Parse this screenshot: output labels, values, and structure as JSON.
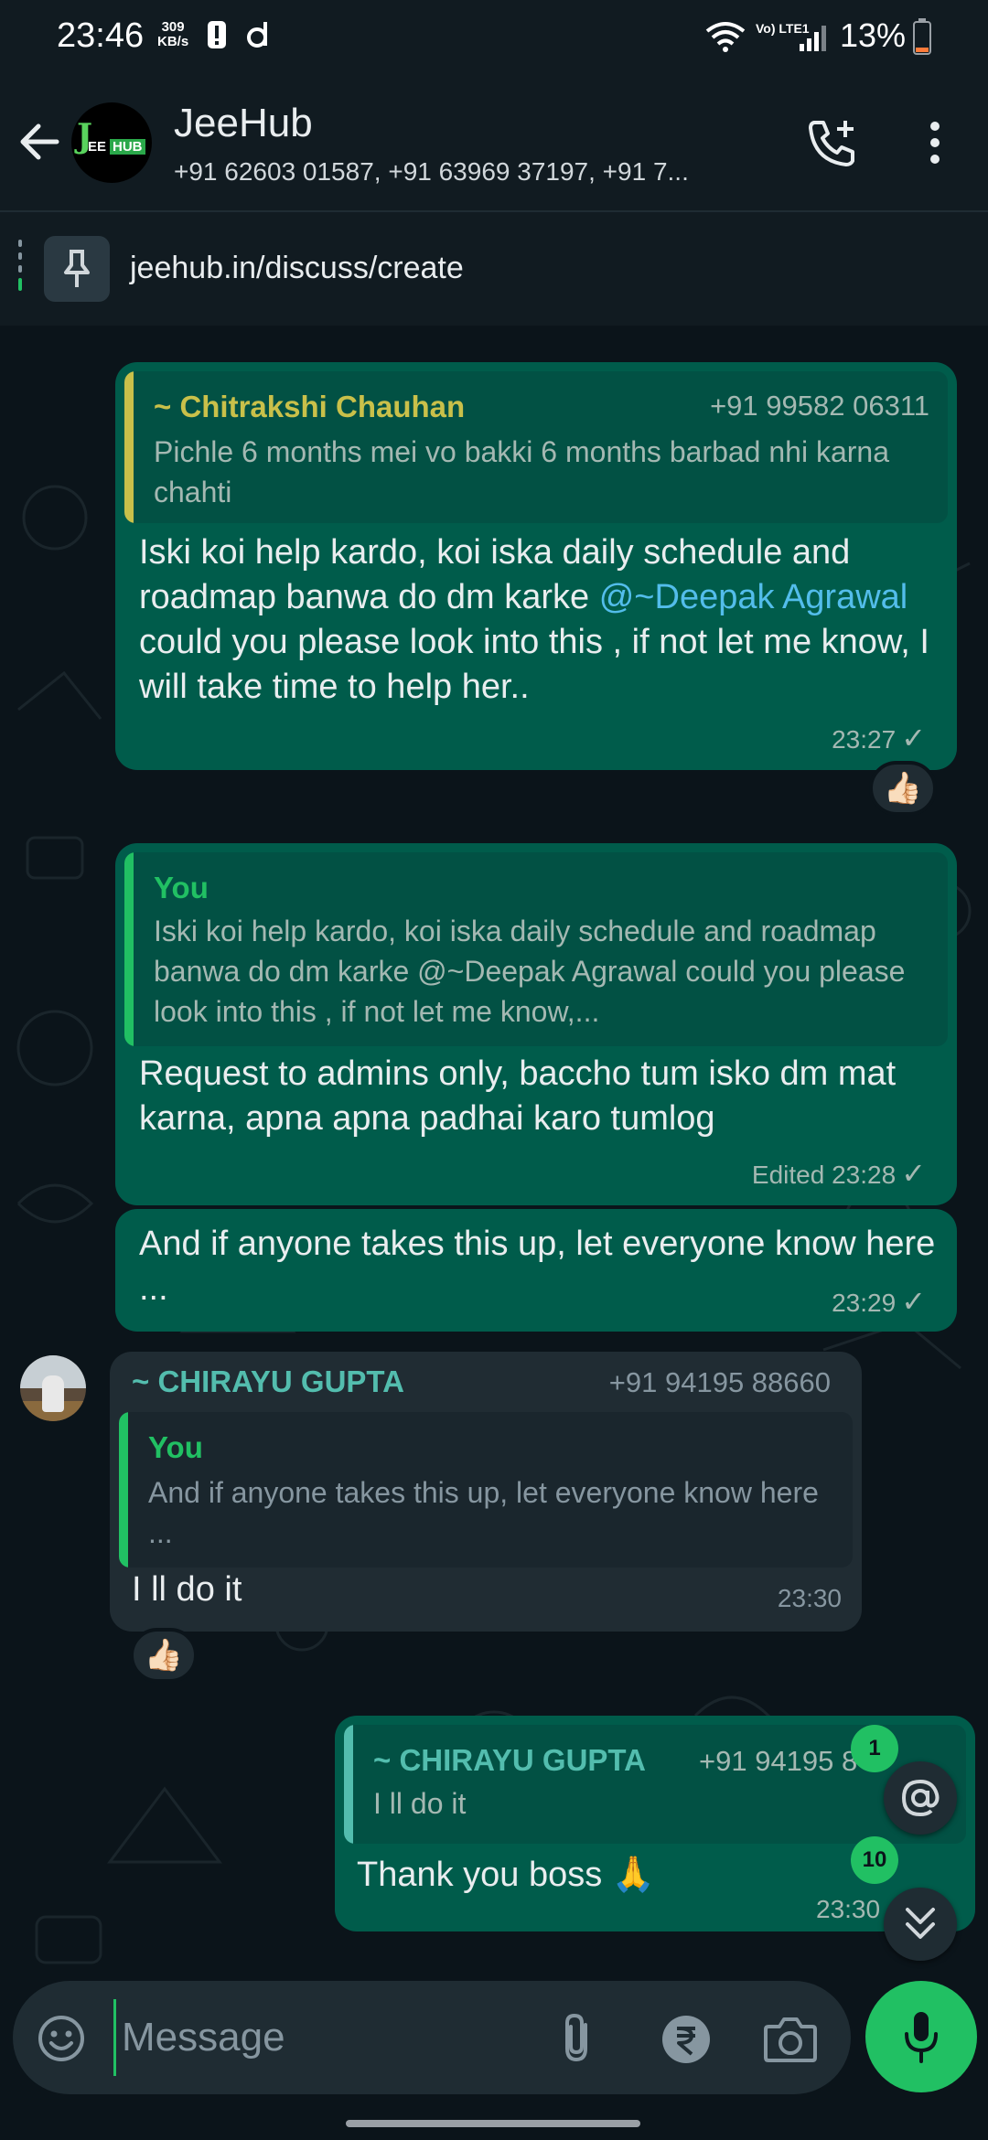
{
  "status_bar": {
    "time": "23:46",
    "speed_value": "309",
    "speed_unit": "KB/s",
    "network": "Vo) LTE1",
    "battery": "13%",
    "icons": [
      "alert-icon",
      "d-app-icon",
      "wifi-icon",
      "signal-icon",
      "battery-icon"
    ]
  },
  "header": {
    "title": "JeeHub",
    "subtitle": "+91 62603 01587, +91 63969 37197, +91 7...",
    "avatar_letters": {
      "j": "J",
      "ee": "EE",
      "hub": "HUB"
    },
    "icons": [
      "back-arrow-icon",
      "add-call-icon",
      "more-vert-icon"
    ]
  },
  "pinned": {
    "text": "jeehub.in/discuss/create",
    "icon": "pin-icon"
  },
  "messages": [
    {
      "direction": "out",
      "quote": {
        "name": "~ Chitrakshi Chauhan",
        "phone": "+91 99582 06311",
        "text": "Pichle 6 months mei vo  bakki 6 months barbad nhi karna chahti",
        "accent": "#c9c04a"
      },
      "text_before": "Iski koi help kardo, koi iska daily schedule and roadmap banwa do dm karke ",
      "mention": "@~Deepak Agrawal",
      "text_after": "  could you please look into this , if not let me know, I will take time to help her..",
      "time": "23:27",
      "reaction": "👍🏻"
    },
    {
      "direction": "out",
      "quote": {
        "name": "You",
        "text": "Iski koi help kardo, koi iska daily schedule and roadmap banwa do dm karke @~Deepak Agrawal could you please look into this , if not let me know,...",
        "accent": "#21c063"
      },
      "text": "Request to admins only, baccho tum isko dm mat karna, apna apna padhai karo tumlog",
      "edited": "Edited",
      "time": "23:28"
    },
    {
      "direction": "out",
      "text": "And if anyone takes this up, let everyone know here ...",
      "time": "23:29"
    },
    {
      "direction": "in",
      "sender": "~ CHIRAYU GUPTA",
      "sender_phone": "+91 94195 88660",
      "quote": {
        "name": "You",
        "text": "And if anyone takes this up, let everyone know here ...",
        "accent": "#21c063"
      },
      "text": "I ll do it",
      "time": "23:30",
      "reaction": "👍🏻"
    },
    {
      "direction": "out",
      "quote": {
        "name": "~ CHIRAYU GUPTA",
        "phone": "+91 94195 8",
        "text": "I ll do it",
        "accent": "#53bdae"
      },
      "text": "Thank you boss 🙏",
      "time": "23:30"
    }
  ],
  "floating": {
    "mention_badge": "1",
    "unread_badge": "10"
  },
  "composer": {
    "placeholder": "Message",
    "icons": [
      "emoji-icon",
      "attach-icon",
      "rupee-icon",
      "camera-icon",
      "mic-icon"
    ]
  },
  "colors": {
    "background": "#0b141a",
    "out_bubble": "#005c4b",
    "in_bubble": "#202c33",
    "accent": "#21c063",
    "mention": "#53bdeb"
  }
}
